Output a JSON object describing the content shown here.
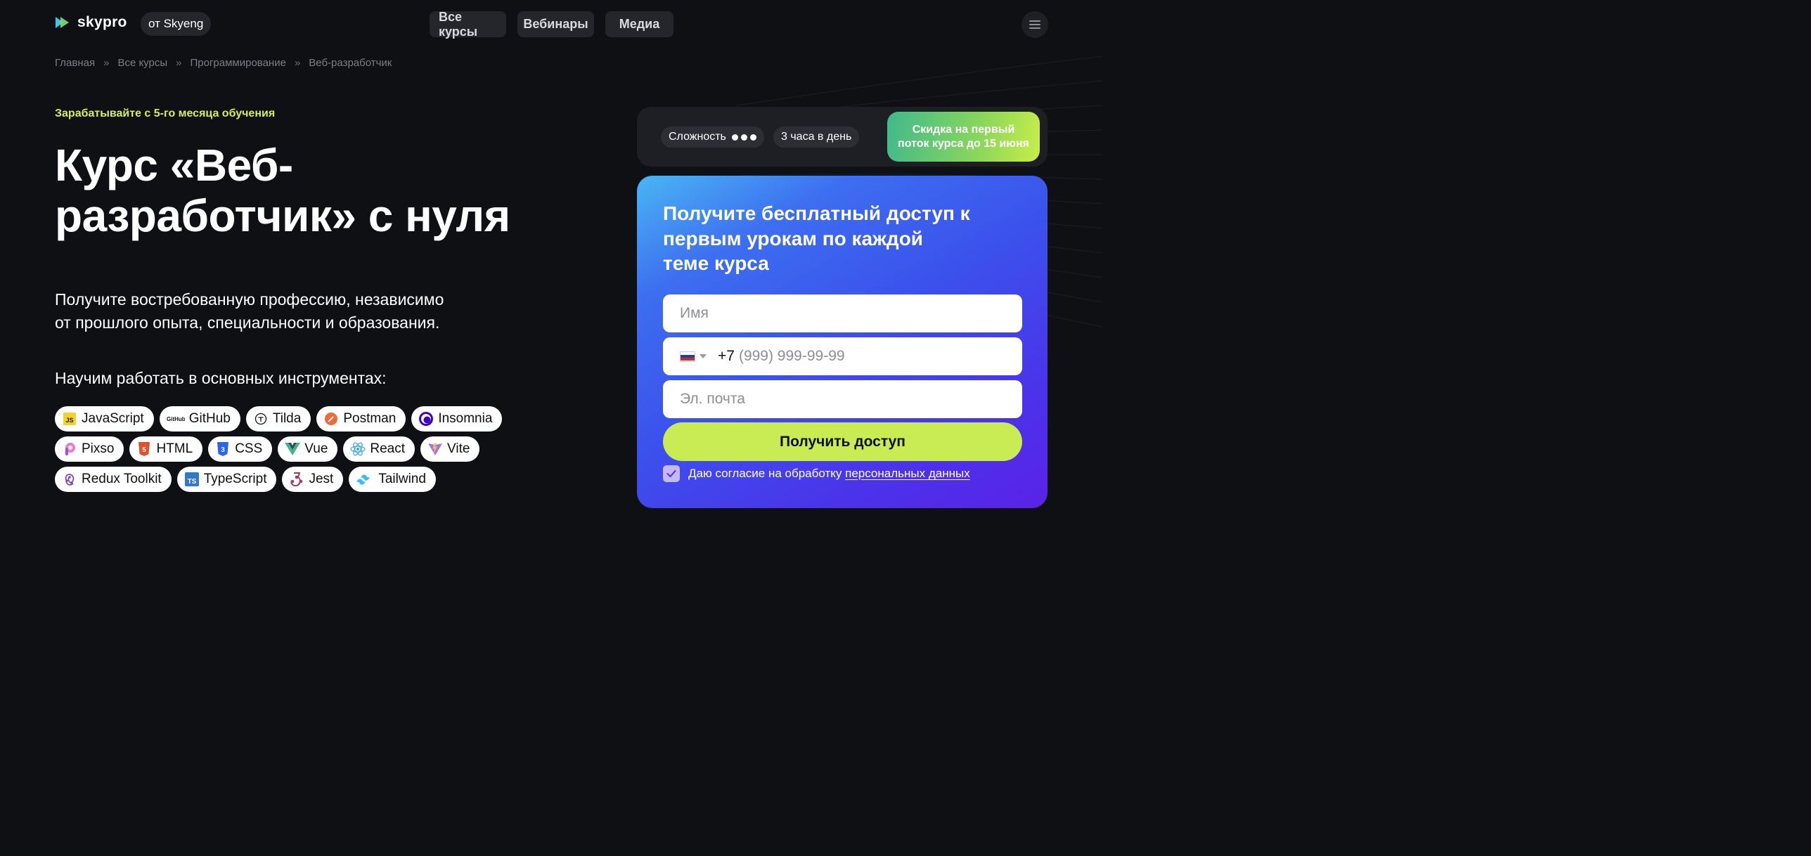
{
  "header": {
    "logo_text": "skypro",
    "logo_badge": "от Skyeng",
    "nav": [
      "Все курсы",
      "Вебинары",
      "Медиа"
    ]
  },
  "breadcrumbs": [
    "Главная",
    "Все курсы",
    "Программирование",
    "Веб-разработчик"
  ],
  "breadcrumb_separator": "»",
  "hero": {
    "eyebrow": "Зарабатывайте с 5-го месяца обучения",
    "title_line1": "Курс «Веб-",
    "title_line2": "разработчик» с нуля",
    "subtitle_line1": "Получите востребованную профессию, независимо",
    "subtitle_line2": "от прошлого опыта, специальности и образования.",
    "tools_title": "Научим работать в основных инструментах:"
  },
  "tools": [
    [
      {
        "label": "JavaScript",
        "icon": "javascript-icon"
      },
      {
        "label": "GitHub",
        "icon": "github-icon"
      },
      {
        "label": "Tilda",
        "icon": "tilda-icon"
      },
      {
        "label": "Postman",
        "icon": "postman-icon"
      },
      {
        "label": "Insomnia",
        "icon": "insomnia-icon"
      }
    ],
    [
      {
        "label": "Pixso",
        "icon": "pixso-icon"
      },
      {
        "label": "HTML",
        "icon": "html-icon"
      },
      {
        "label": "CSS",
        "icon": "css-icon"
      },
      {
        "label": "Vue",
        "icon": "vue-icon"
      },
      {
        "label": "React",
        "icon": "react-icon"
      },
      {
        "label": "Vite",
        "icon": "vite-icon"
      }
    ],
    [
      {
        "label": "Redux Toolkit",
        "icon": "redux-icon"
      },
      {
        "label": "TypeScript",
        "icon": "typescript-icon"
      },
      {
        "label": "Jest",
        "icon": "jest-icon"
      },
      {
        "label": "Tailwind",
        "icon": "tailwind-icon"
      }
    ]
  ],
  "info": {
    "difficulty_label": "Сложность",
    "difficulty_level": 3,
    "time_label": "3 часа в день",
    "promo_line1": "Скидка на первый",
    "promo_line2": "поток курса до 15 июня"
  },
  "form": {
    "title": "Получите бесплатный доступ к первым урокам по каждой теме курса",
    "name_placeholder": "Имя",
    "phone_code": "+7",
    "phone_placeholder": "(999) 999-99-99",
    "email_placeholder": "Эл. почта",
    "submit_label": "Получить доступ",
    "consent_text": "Даю согласие на обработку",
    "consent_link": "персональных данных",
    "consent_checked": true
  },
  "colors": {
    "background": "#0f1014",
    "accent_lime": "#c9ec54",
    "eyebrow": "#d4ef5c",
    "form_gradient_start": "#4ab6f4",
    "form_gradient_end": "#5a22e8"
  }
}
